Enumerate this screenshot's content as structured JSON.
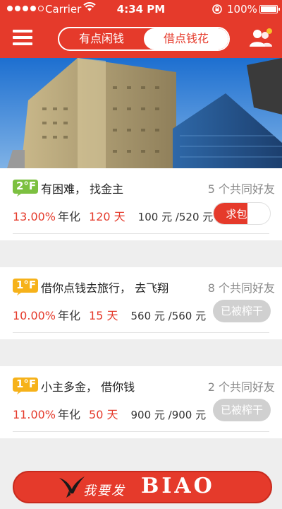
{
  "status_bar": {
    "carrier": "Carrier",
    "time": "4:34 PM",
    "battery": "100%"
  },
  "nav": {
    "segments": [
      "有点闲钱",
      "借点钱花"
    ],
    "active_segment": 1
  },
  "loans": [
    {
      "floor": "2°F",
      "floor_color": "#7cc040",
      "title": "有困难， 找金主",
      "mutual_friends": "5 个共同好友",
      "rate": "13.00%",
      "rate_label": "年化",
      "days": "120 天",
      "amount": "100 元 /520 元",
      "button": "求包养",
      "button_state": "active",
      "progress": 0.19
    },
    {
      "floor": "1°F",
      "floor_color": "#f6b21a",
      "title": "借你点钱去旅行， 去飞翔",
      "mutual_friends": "8 个共同好友",
      "rate": "10.00%",
      "rate_label": "年化",
      "days": "15 天",
      "amount": "560 元 /560 元",
      "button": "已被榨干",
      "button_state": "disabled",
      "progress": 1.0
    },
    {
      "floor": "1°F",
      "floor_color": "#f6b21a",
      "title": "小主多金， 借你钱",
      "mutual_friends": "2 个共同好友",
      "rate": "11.00%",
      "rate_label": "年化",
      "days": "50 天",
      "amount": "900 元 /900 元",
      "button": "已被榨干",
      "button_state": "disabled",
      "progress": 1.0
    }
  ],
  "bottom_button": {
    "cn": "我要发",
    "en": "BIAO"
  },
  "colors": {
    "brand_red": "#e53a2b",
    "disabled_gray": "#d0d0d0"
  },
  "icons": {
    "menu": "menu-icon",
    "friends": "friends-icon",
    "wifi": "wifi-icon",
    "lock": "rotation-lock-icon",
    "battery": "battery-icon",
    "bird": "bird-logo-icon"
  }
}
